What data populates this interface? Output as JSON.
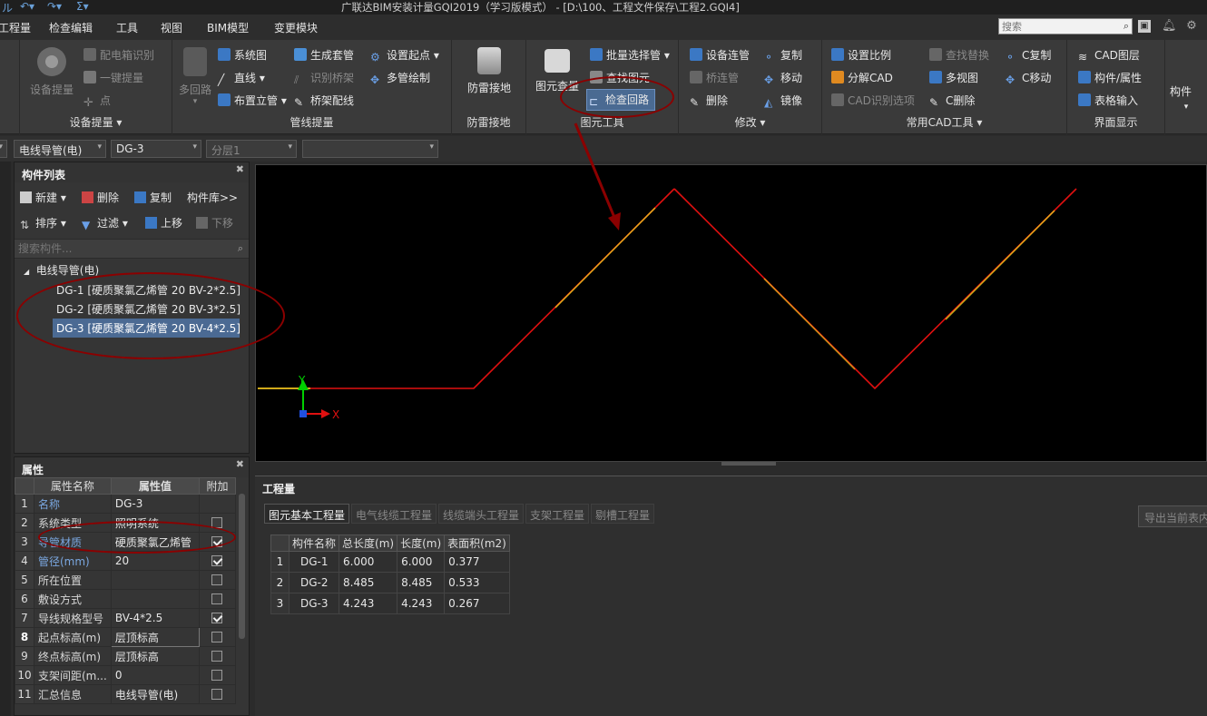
{
  "titlebar": {
    "title": "广联达BIM安装计量GQI2019（学习版模式） - [D:\\100、工程文件保存\\工程2.GQI4]"
  },
  "menubar": {
    "items": [
      "工程量",
      "检查编辑",
      "工具",
      "视图",
      "BIM模型",
      "变更模块"
    ],
    "search_placeholder": "搜索"
  },
  "ribbon": {
    "groups": {
      "equipment": {
        "label": "设备提量",
        "big_button": "设备提量",
        "buttons": [
          "配电箱识别",
          "一键提量",
          "点"
        ]
      },
      "pipeline": {
        "label": "管线提量",
        "big_button": "多回路",
        "buttons": [
          "系统图",
          "直线",
          "布置立管",
          "生成套管",
          "识别桥架",
          "桥架配线",
          "设置起点",
          "多管绘制"
        ]
      },
      "lightning": {
        "label": "防雷接地",
        "big_button": "防雷接地"
      },
      "element_tools": {
        "label": "图元工具",
        "big_button": "图元查量",
        "buttons": [
          "批量选择管",
          "查找图元",
          "检查回路"
        ]
      },
      "modify": {
        "label": "修改",
        "buttons": [
          "设备连管",
          "桥连管",
          "删除",
          "复制",
          "移动",
          "镜像"
        ]
      },
      "cad": {
        "label": "常用CAD工具",
        "buttons": [
          "设置比例",
          "分解CAD",
          "CAD识别选项",
          "查找替换",
          "多视图",
          "C删除",
          "C复制",
          "C移动"
        ]
      },
      "ui": {
        "label": "界面显示",
        "buttons": [
          "CAD图层",
          "构件/属性",
          "表格输入"
        ]
      },
      "component": {
        "label": "构件"
      }
    }
  },
  "selectors": {
    "type": "电线导管(电)",
    "component": "DG-3",
    "layer": "分层1",
    "extra": ""
  },
  "component_list": {
    "title": "构件列表",
    "tools": [
      "新建",
      "删除",
      "复制",
      "构件库>>",
      "排序",
      "过滤",
      "上移",
      "下移"
    ],
    "search_placeholder": "搜索构件...",
    "parent": "电线导管(电)",
    "items": [
      "DG-1 [硬质聚氯乙烯管 20 BV-2*2.5]",
      "DG-2 [硬质聚氯乙烯管 20 BV-3*2.5]",
      "DG-3 [硬质聚氯乙烯管 20 BV-4*2.5]"
    ]
  },
  "properties": {
    "title": "属性",
    "headers": [
      "属性名称",
      "属性值",
      "附加"
    ],
    "rows": [
      {
        "idx": "1",
        "name": "名称",
        "value": "DG-3"
      },
      {
        "idx": "2",
        "name": "系统类型",
        "value": "照明系统"
      },
      {
        "idx": "3",
        "name": "导管材质",
        "value": "硬质聚氯乙烯管"
      },
      {
        "idx": "4",
        "name": "管径(mm)",
        "value": "20"
      },
      {
        "idx": "5",
        "name": "所在位置",
        "value": ""
      },
      {
        "idx": "6",
        "name": "敷设方式",
        "value": ""
      },
      {
        "idx": "7",
        "name": "导线规格型号",
        "value": "BV-4*2.5"
      },
      {
        "idx": "8",
        "name": "起点标高(m)",
        "value": "层顶标高"
      },
      {
        "idx": "9",
        "name": "终点标高(m)",
        "value": "层顶标高"
      },
      {
        "idx": "10",
        "name": "支架间距(m...",
        "value": "0"
      },
      {
        "idx": "11",
        "name": "汇总信息",
        "value": "电线导管(电)"
      }
    ]
  },
  "canvas": {
    "axis_y": "Y",
    "axis_x": "X"
  },
  "quantity": {
    "title": "工程量",
    "tabs": [
      "图元基本工程量",
      "电气线缆工程量",
      "线缆端头工程量",
      "支架工程量",
      "剔槽工程量"
    ],
    "export_button": "导出当前表内",
    "headers": [
      "构件名称",
      "总长度(m)",
      "长度(m)",
      "表面积(m2)"
    ],
    "rows": [
      {
        "idx": "1",
        "name": "DG-1",
        "total": "6.000",
        "length": "6.000",
        "area": "0.377"
      },
      {
        "idx": "2",
        "name": "DG-2",
        "total": "8.485",
        "length": "8.485",
        "area": "0.533"
      },
      {
        "idx": "3",
        "name": "DG-3",
        "total": "4.243",
        "length": "4.243",
        "area": "0.267"
      }
    ]
  },
  "colors": {
    "selection": "#4b6a93",
    "annotation": "#8b0000",
    "line_red": "#e01010",
    "line_yellow": "#f0e020"
  }
}
